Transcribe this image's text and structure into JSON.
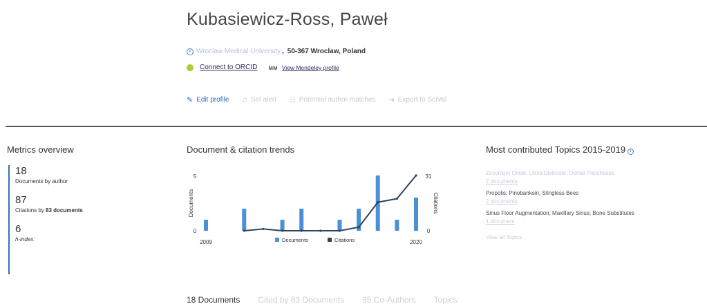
{
  "profile": {
    "name": "Kubasiewicz-Ross, Paweł",
    "affiliation_institution": "Wroclaw Medical University",
    "affiliation_location": "50-367 Wroclaw, Poland",
    "orcid_link": "Connect to ORCID",
    "mendeley_link": "View Mendeley profile"
  },
  "actions": [
    {
      "label": "Edit profile",
      "icon": "pencil-icon",
      "active": true
    },
    {
      "label": "Set alert",
      "icon": "bell-icon",
      "active": false
    },
    {
      "label": "Potential author matches",
      "icon": "people-icon",
      "active": false
    },
    {
      "label": "Export to SciVal",
      "icon": "export-icon",
      "active": false
    }
  ],
  "metrics": {
    "title": "Metrics overview",
    "documents": {
      "value": "18",
      "label": "Documents by author"
    },
    "citations": {
      "value": "87",
      "label_prefix": "Citations by ",
      "label_bold": "83 documents"
    },
    "hindex": {
      "value": "6",
      "label": "h-index:"
    }
  },
  "trends": {
    "title": "Document & citation trends"
  },
  "chart_data": {
    "type": "bar",
    "x": [
      2009,
      2010,
      2011,
      2012,
      2013,
      2014,
      2015,
      2016,
      2017,
      2018,
      2019,
      2020
    ],
    "xlabel_start": "2009",
    "xlabel_end": "2020",
    "series": [
      {
        "name": "Documents",
        "type": "bar",
        "axis": "left",
        "color": "#4a90d9",
        "values": [
          1,
          0,
          2,
          0,
          1,
          2,
          0,
          1,
          2,
          5,
          1,
          3
        ]
      },
      {
        "name": "Citations",
        "type": "line",
        "axis": "right",
        "color": "#2f4460",
        "values": [
          null,
          null,
          0,
          1,
          0,
          0,
          0,
          0,
          2,
          16,
          18,
          31
        ]
      }
    ],
    "ylabel_left": "Documents",
    "ylabel_right": "Citations",
    "ylim_left": [
      0,
      5
    ],
    "ylim_right": [
      0,
      31
    ],
    "yticks_left": [
      "0",
      "5"
    ],
    "yticks_right": [
      "0",
      "31"
    ],
    "legend": "bottom"
  },
  "topics": {
    "title": "Most contributed Topics 2015-2019",
    "items": [
      {
        "name": "Zirconium Oxide; Lithia Disilicate; Dental Prostheses",
        "count": "2 documents",
        "faded": true
      },
      {
        "name": "Propolis; Pinobanksin; Stingless Bees",
        "count": "2 documents",
        "faded": false
      },
      {
        "name": "Sinus Floor Augmentation; Maxillary Sinus; Bone Substitutes",
        "count": "1 document",
        "faded": false
      }
    ],
    "view_all": "View all Topics"
  },
  "tabs": [
    {
      "label": "18 Documents",
      "active": true
    },
    {
      "label": "Cited by 83 Documents",
      "active": false
    },
    {
      "label": "35 Co-Authors",
      "active": false
    },
    {
      "label": "Topics",
      "active": false
    }
  ]
}
